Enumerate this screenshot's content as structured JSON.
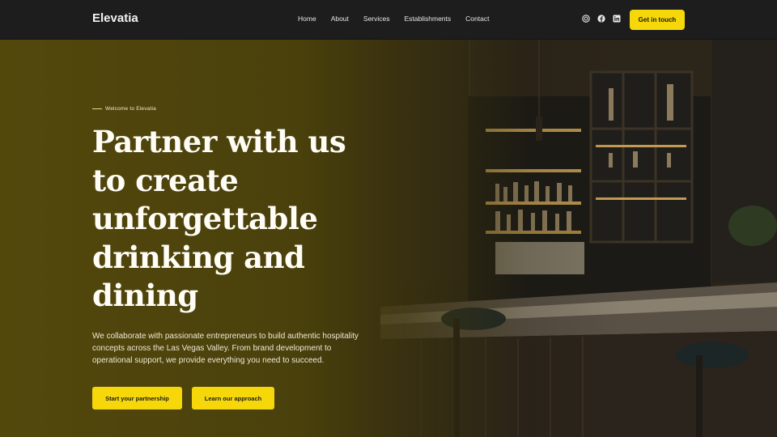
{
  "header": {
    "brand": "Elevatia",
    "nav": [
      "Home",
      "About",
      "Services",
      "Establishments",
      "Contact"
    ],
    "socials": [
      "instagram-icon",
      "facebook-icon",
      "linkedin-icon"
    ],
    "cta_label": "Get in touch"
  },
  "hero": {
    "eyebrow": "Welcome to Elevatia",
    "title": "Partner with us to create unforgettable drinking and dining",
    "description": "We collaborate with passionate entrepreneurs to build authentic hospitality concepts across the Las Vegas Valley. From brand development to operational support, we provide everything you need to succeed.",
    "primary_button": "Start your partnership",
    "secondary_button": "Learn our approach"
  },
  "colors": {
    "accent": "#f6d80a",
    "header_bg": "#1d1d1d",
    "hero_overlay": "#544a0c"
  }
}
